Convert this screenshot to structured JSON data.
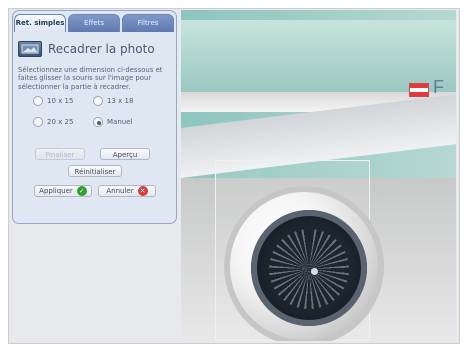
{
  "tabs": [
    "Ret. simples",
    "Effets",
    "Filtres"
  ],
  "panel": {
    "title": "Recadrer la photo",
    "description": "Sélectionnez une dimension ci-dessous et faites glisser la souris sur l'image pour sélectionner la partie à recadrer.",
    "options": [
      {
        "label": "10 x 15",
        "selected": false
      },
      {
        "label": "13 x 18",
        "selected": false
      },
      {
        "label": "20 x 25",
        "selected": false
      },
      {
        "label": "Manuel",
        "selected": true
      }
    ],
    "buttons": {
      "finalize": "Finaliser",
      "preview": "Aperçu",
      "reset": "Réinitialiser",
      "apply": "Appliquer",
      "cancel": "Annuler"
    }
  },
  "image": {
    "flag_text": "F"
  }
}
